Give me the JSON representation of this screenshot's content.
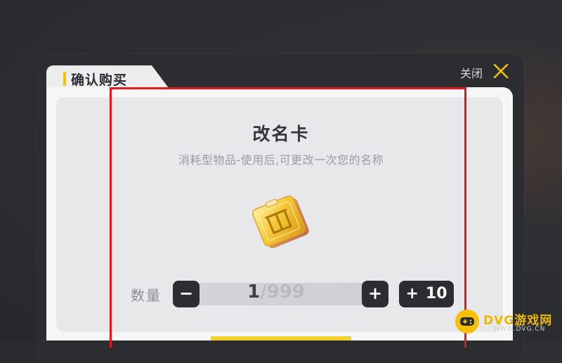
{
  "dialog": {
    "tab_title": "确认购买",
    "close_label": "关闭"
  },
  "item": {
    "name": "改名卡",
    "description": "消耗型物品-使用后,可更改一次您的名称",
    "icon": "rename-card-icon"
  },
  "quantity": {
    "label": "数量",
    "current": "1",
    "max": "/999",
    "minus_label": "−",
    "plus_label": "+",
    "plus10_sign": "+",
    "plus10_value": "10"
  },
  "watermark": {
    "title": "DVG游戏网",
    "url": "WWW.DVG.CN"
  },
  "colors": {
    "accent": "#f2c400",
    "highlight": "#e5161c",
    "button_bg": "#2b2d33",
    "panel_bg": "#e8e8ea"
  }
}
